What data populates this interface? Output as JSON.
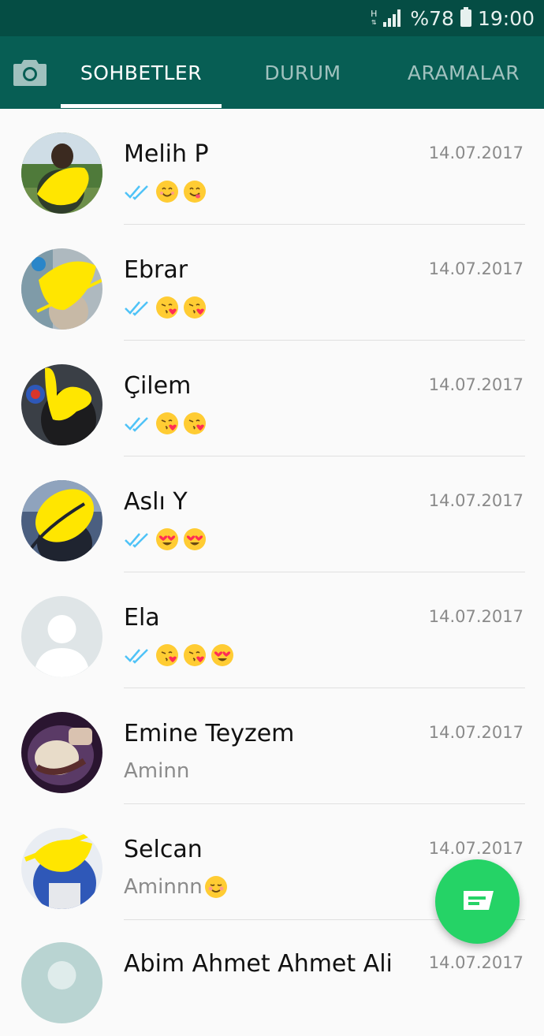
{
  "status_bar": {
    "network_type": "H",
    "battery": "%78",
    "time": "19:00",
    "icons": [
      "signal-icon",
      "battery-icon"
    ]
  },
  "tabs": [
    {
      "id": "camera",
      "icon": "camera-icon"
    },
    {
      "id": "chats",
      "label": "SOHBETLER",
      "active": true
    },
    {
      "id": "status",
      "label": "DURUM",
      "active": false
    },
    {
      "id": "calls",
      "label": "ARAMALAR",
      "active": false
    }
  ],
  "chats": [
    {
      "name": "Melih P",
      "time": "14.07.2017",
      "read_receipt": true,
      "emojis": [
        "smiling-face",
        "savoring-face"
      ],
      "text": ""
    },
    {
      "name": "Ebrar",
      "time": "14.07.2017",
      "read_receipt": true,
      "emojis": [
        "kissing-face",
        "kissing-face"
      ],
      "text": ""
    },
    {
      "name": "Çilem",
      "time": "14.07.2017",
      "read_receipt": true,
      "emojis": [
        "kissing-face",
        "kissing-face"
      ],
      "text": ""
    },
    {
      "name": "Aslı Y",
      "time": "14.07.2017",
      "read_receipt": true,
      "emojis": [
        "heart-eyes-face",
        "heart-eyes-face"
      ],
      "text": ""
    },
    {
      "name": "Ela",
      "time": "14.07.2017",
      "read_receipt": true,
      "emojis": [
        "kissing-face",
        "kissing-face",
        "heart-eyes-face"
      ],
      "text": ""
    },
    {
      "name": "Emine Teyzem",
      "time": "14.07.2017",
      "read_receipt": false,
      "emojis": [],
      "text": "Aminn"
    },
    {
      "name": "Selcan",
      "time": "14.07.2017",
      "read_receipt": false,
      "emojis": [
        "blushing-face"
      ],
      "text": "Aminnn"
    },
    {
      "name": "Abim Ahmet Ahmet Ali",
      "time": "14.07.2017",
      "read_receipt": false,
      "emojis": [],
      "text": ""
    }
  ],
  "fab": {
    "icon": "new-chat-icon"
  },
  "colors": {
    "status_bar": "#054d44",
    "app_bar": "#075e54",
    "fab": "#25d366",
    "check_blue": "#4fc3f7",
    "scribble_yellow": "#ffe600"
  }
}
